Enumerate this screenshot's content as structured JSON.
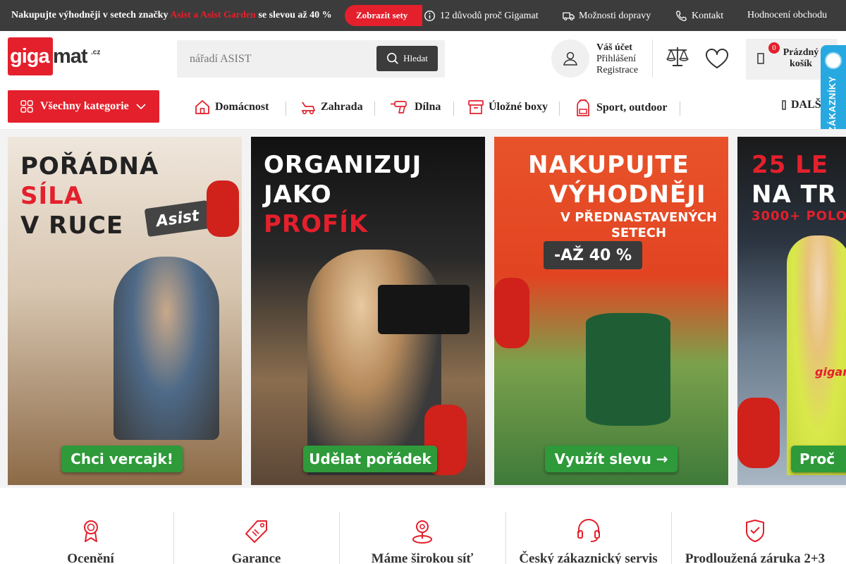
{
  "topbar": {
    "promo_prefix": "Nakupujte výhodněji v setech značky ",
    "promo_highlight": "Asist a Asist Garden",
    "promo_suffix": " se slevou až 40 %",
    "promo_button": "Zobrazit sety",
    "links": [
      {
        "label": "12 důvodů proč Gigamat",
        "icon": "info-icon"
      },
      {
        "label": "Možnosti dopravy",
        "icon": "truck-icon"
      },
      {
        "label": "Kontakt",
        "icon": "phone-icon"
      },
      {
        "label": "Hodnocení obchodu",
        "icon": ""
      }
    ]
  },
  "logo": {
    "red_part": "giga",
    "dark_part": "mat",
    "tld": ".cz"
  },
  "search": {
    "placeholder": "nářadí ASIST",
    "button_label": "Hledat"
  },
  "account": {
    "title": "Váš účet",
    "login": "Přihlášení",
    "register": "Registrace"
  },
  "cart": {
    "count": "0",
    "line1": "Prázdný",
    "line2": "košík"
  },
  "verified_badge": {
    "text": "OVĚŘENO ZÁKAZNÍKY"
  },
  "nav": {
    "all_categories": "Všechny kategorie",
    "items": [
      {
        "label": "Domácnost",
        "icon": "house-icon"
      },
      {
        "label": "Zahrada",
        "icon": "lawnmower-icon"
      },
      {
        "label": "Dílna",
        "icon": "drill-icon"
      },
      {
        "label": "Úložné boxy",
        "icon": "box-icon"
      },
      {
        "label": "Sport, outdoor",
        "icon": "backpack-icon"
      }
    ],
    "more": "DALŠ"
  },
  "banners": [
    {
      "line1": "POŘÁDNÁ",
      "line2": "SÍLA",
      "line3": "V RUCE",
      "brand": "Asist",
      "cta": "Chci vercajk!"
    },
    {
      "line1": "ORGANIZUJ",
      "line2": "JAKO",
      "line3": "PROFÍK",
      "cta": "Udělat pořádek"
    },
    {
      "line1": "NAKUPUJTE",
      "line2": "VÝHODNĚJI",
      "sub1": "V PŘEDNASTAVENÝCH",
      "sub2": "SETECH",
      "badge": "-AŽ 40 %",
      "cta": "Využít slevu →"
    },
    {
      "line1": "25 LE",
      "line2": "NA TR",
      "sub1": "3000+ POLO",
      "brand": "gigan",
      "cta": "Proč"
    }
  ],
  "benefits": [
    {
      "label": "Ocenění",
      "icon": "award-icon"
    },
    {
      "label": "Garance",
      "icon": "price-tag-icon"
    },
    {
      "label": "Máme širokou síť",
      "icon": "location-pin-icon"
    },
    {
      "label": "Český zákaznický servis",
      "icon": "headset-icon"
    },
    {
      "label": "Prodloužená záruka 2+3",
      "icon": "shield-check-icon"
    }
  ],
  "colors": {
    "accent": "#e3202c",
    "dark": "#3c3c3c",
    "cta_green": "#2e9a3a",
    "verified_blue": "#28a8e0"
  }
}
